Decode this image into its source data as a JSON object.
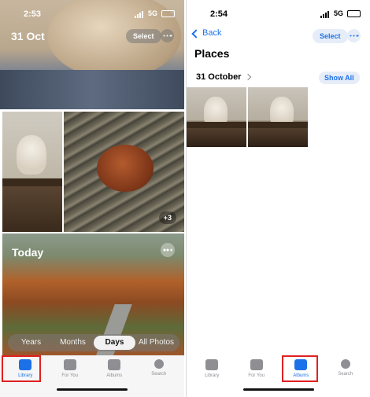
{
  "left": {
    "status": {
      "time": "2:53",
      "network": "5G"
    },
    "header": {
      "date": "31 Oct",
      "select_label": "Select"
    },
    "tile_badge": "+3",
    "today_label": "Today",
    "segments": [
      "Years",
      "Months",
      "Days",
      "All Photos"
    ],
    "active_segment": "Days",
    "tabs": [
      "Library",
      "For You",
      "Albums",
      "Search"
    ],
    "active_tab": "Library"
  },
  "right": {
    "status": {
      "time": "2:54",
      "network": "5G"
    },
    "nav": {
      "back_label": "Back",
      "select_label": "Select"
    },
    "title": "Places",
    "section": {
      "label": "31 October",
      "show_all_label": "Show All"
    },
    "tabs": [
      "Library",
      "For You",
      "Albums",
      "Search"
    ],
    "active_tab": "Albums"
  },
  "colors": {
    "accent": "#1d71e8",
    "highlight": "#e02020",
    "battery": "#f5c31a"
  },
  "icons": [
    "back-chevron-icon",
    "library-icon",
    "for-you-icon",
    "albums-icon",
    "search-icon",
    "more-dots-icon"
  ]
}
